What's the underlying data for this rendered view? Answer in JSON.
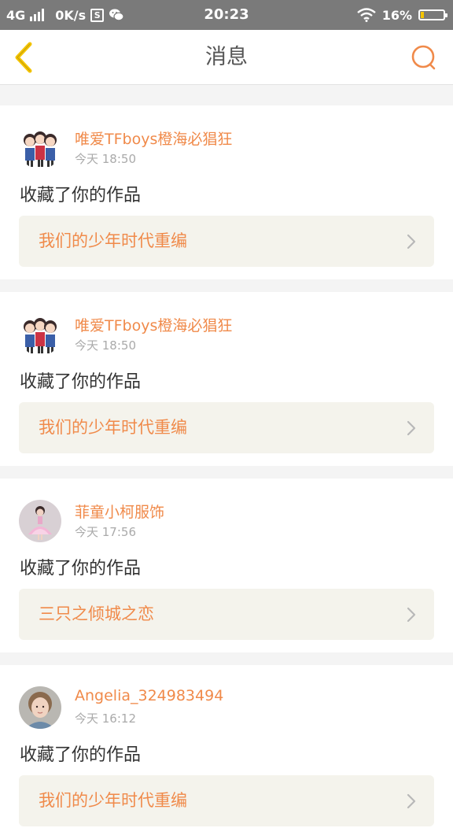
{
  "status_bar": {
    "network": "4G",
    "speed": "0K/s",
    "s_icon_label": "S",
    "time": "20:23",
    "battery": "16%",
    "battery_level": 0.16
  },
  "header": {
    "title": "消息",
    "accent_color": "#f08a4a"
  },
  "messages": [
    {
      "username": "唯爱TFboys橙海必猖狂",
      "time": "今天 18:50",
      "action": "收藏了你的作品",
      "work_title": "我们的少年时代重编",
      "avatar": "group-kids-avatar"
    },
    {
      "username": "唯爱TFboys橙海必猖狂",
      "time": "今天 18:50",
      "action": "收藏了你的作品",
      "work_title": "我们的少年时代重编",
      "avatar": "group-kids-avatar"
    },
    {
      "username": "菲童小柯服饰",
      "time": "今天 17:56",
      "action": "收藏了你的作品",
      "work_title": "三只之倾城之恋",
      "avatar": "girl-dress-avatar"
    },
    {
      "username": "Angelia_324983494",
      "time": "今天 16:12",
      "action": "收藏了你的作品",
      "work_title": "我们的少年时代重编",
      "avatar": "portrait-avatar"
    }
  ]
}
